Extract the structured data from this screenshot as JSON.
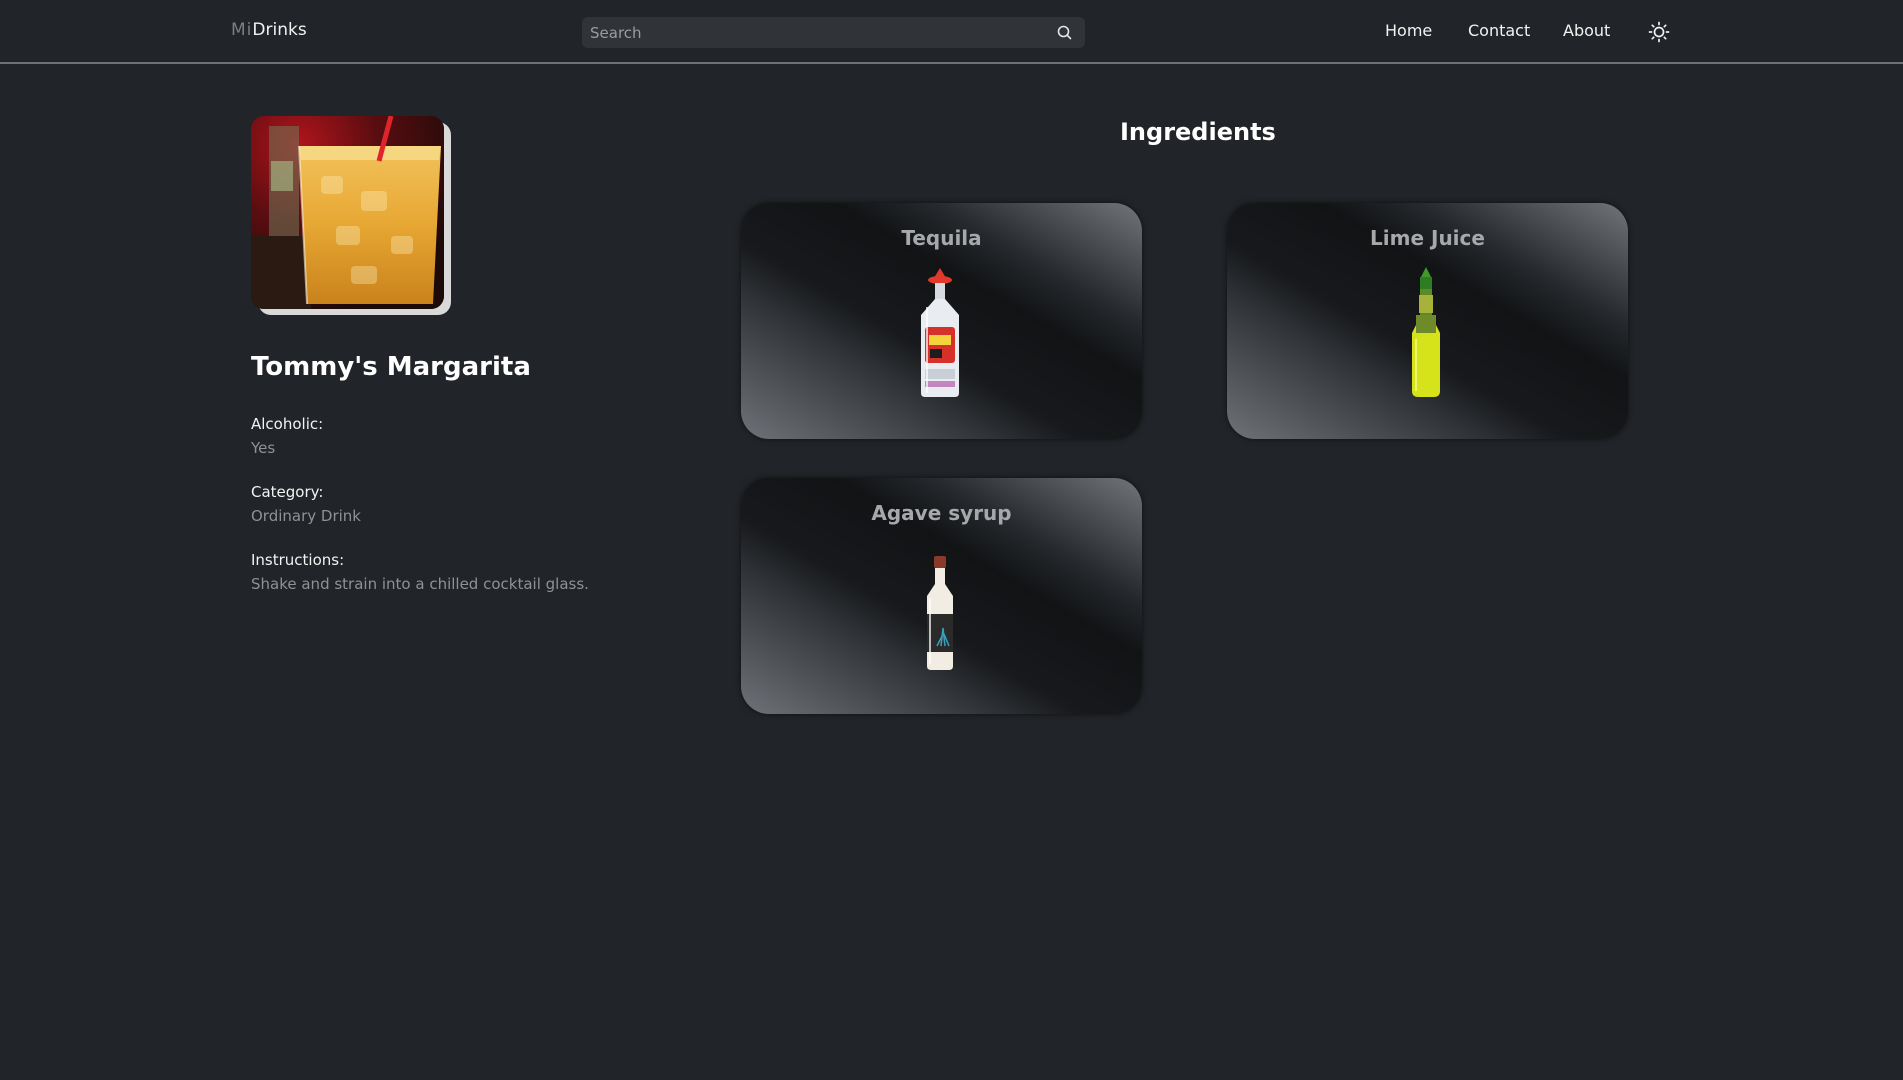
{
  "header": {
    "logo_mi": "Mi",
    "logo_drinks": "Drinks",
    "search_placeholder": "Search",
    "nav": {
      "home": "Home",
      "contact": "Contact",
      "about": "About"
    }
  },
  "drink": {
    "name": "Tommy's Margarita",
    "alcoholic_label": "Alcoholic:",
    "alcoholic_value": "Yes",
    "category_label": "Category:",
    "category_value": "Ordinary Drink",
    "instructions_label": "Instructions:",
    "instructions_value": "Shake and strain into a chilled cocktail glass."
  },
  "ingredients": {
    "heading": "Ingredients",
    "items": [
      {
        "name": "Tequila",
        "icon": "tequila-bottle-icon"
      },
      {
        "name": "Lime Juice",
        "icon": "lime-juice-bottle-icon"
      },
      {
        "name": "Agave syrup",
        "icon": "agave-syrup-bottle-icon"
      }
    ]
  },
  "icons": {
    "search": "search-icon",
    "theme": "sun-icon"
  },
  "colors": {
    "background": "#212428",
    "divider": "#6e7176",
    "muted_text": "#8e9196",
    "card_title": "#a6a8ab"
  }
}
